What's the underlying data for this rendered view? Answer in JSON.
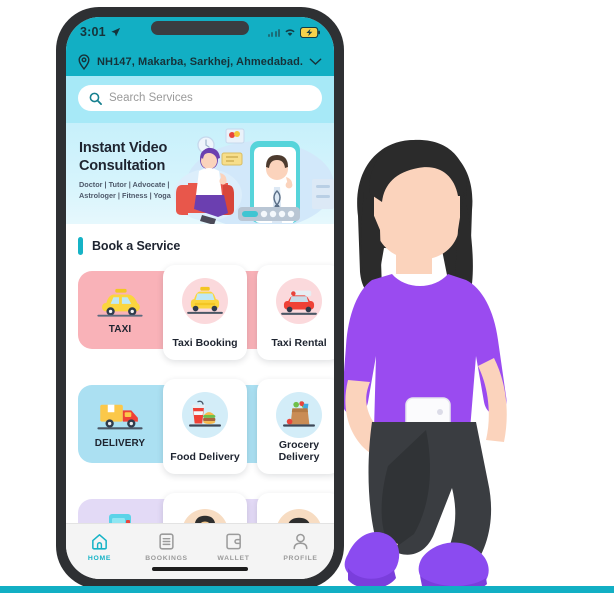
{
  "status_bar": {
    "time": "3:01",
    "nav_arrow_icon": "navigation-arrow-icon",
    "signal_icon": "signal-bars-icon",
    "wifi_icon": "wifi-icon",
    "battery_icon": "battery-charging-icon"
  },
  "location_bar": {
    "pin_icon": "location-pin-icon",
    "address": "NH147, Makarba, Sarkhej, Ahmedabad...",
    "chevron_icon": "chevron-down-icon"
  },
  "search": {
    "icon": "search-icon",
    "placeholder": "Search Services",
    "value": ""
  },
  "banner": {
    "title": "Instant Video\nConsultation",
    "subtitle": "Doctor | Tutor | Advocate | Astrologer | Fitness | Yoga",
    "bg_color": "#C7F0FB"
  },
  "section": {
    "title": "Book a Service",
    "accent_color": "#16B3C6"
  },
  "categories": [
    {
      "badge_label": "TAXI",
      "badge_icon": "taxi-car-icon",
      "strip_color": "#F9B2B8",
      "tile_circle_color": "#FBD9DC",
      "tiles": [
        {
          "label": "Taxi Booking",
          "icon": "taxi-front-icon"
        },
        {
          "label": "Taxi Rental",
          "icon": "car-rental-icon"
        }
      ]
    },
    {
      "badge_label": "DELIVERY",
      "badge_icon": "delivery-truck-icon",
      "strip_color": "#ABE0F2",
      "tile_circle_color": "#D3EDF8",
      "tiles": [
        {
          "label": "Food Delivery",
          "icon": "burger-drink-icon"
        },
        {
          "label": "Grocery\nDelivery",
          "icon": "grocery-bag-icon"
        }
      ]
    },
    {
      "badge_label": "",
      "badge_icon": "vending-machine-icon",
      "strip_color": "#E3DAF6",
      "tile_circle_color": "#F7DCC2",
      "tiles": [
        {
          "label": "",
          "icon": "person-avatar-icon"
        },
        {
          "label": "",
          "icon": "person-cap-avatar-icon"
        }
      ]
    }
  ],
  "bottom_nav": [
    {
      "label": "HOME",
      "icon": "home-icon",
      "active": true
    },
    {
      "label": "BOOKINGS",
      "icon": "list-icon",
      "active": false
    },
    {
      "label": "WALLET",
      "icon": "wallet-icon",
      "active": false
    },
    {
      "label": "PROFILE",
      "icon": "person-icon",
      "active": false
    }
  ],
  "illustration": {
    "name": "walking-woman-with-phone",
    "shirt_color": "#9A4BF0",
    "pants_color": "#3A3D41",
    "shoes_color": "#8B4BF0",
    "hair_color": "#2B2B2B",
    "skin_color": "#FBD3BC"
  },
  "accent_rule_color": "#12AFC4"
}
